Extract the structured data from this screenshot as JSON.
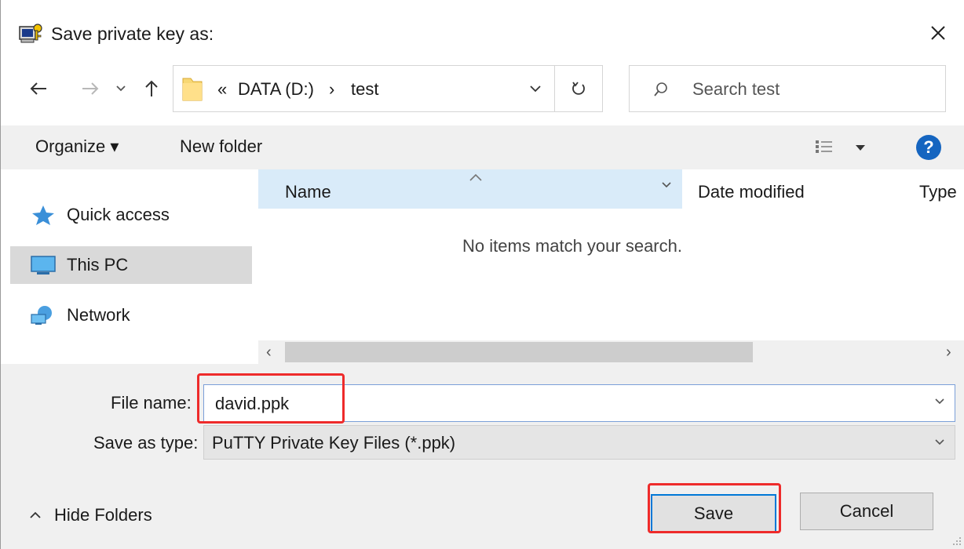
{
  "window": {
    "title": "Save private key as:"
  },
  "navigation": {
    "breadcrumb_prefix": "«",
    "breadcrumbs": [
      "DATA (D:)",
      "test"
    ],
    "breadcrumb_separator": "›",
    "search_placeholder": "Search test"
  },
  "toolbar": {
    "organize_label": "Organize ▾",
    "new_folder_label": "New folder"
  },
  "sidebar": {
    "items": [
      {
        "label": "Quick access",
        "icon": "star-icon"
      },
      {
        "label": "This PC",
        "icon": "computer-icon",
        "selected": true
      },
      {
        "label": "Network",
        "icon": "network-icon"
      }
    ]
  },
  "file_list": {
    "columns": [
      "Name",
      "Date modified",
      "Type"
    ],
    "empty_message": "No items match your search."
  },
  "form": {
    "filename_label": "File name:",
    "filename_value": "david.ppk",
    "savetype_label": "Save as type:",
    "savetype_value": "PuTTY Private Key Files (*.ppk)"
  },
  "footer": {
    "hide_folders_label": "Hide Folders",
    "save_label": "Save",
    "cancel_label": "Cancel"
  },
  "colors": {
    "accent": "#0078d7",
    "highlight": "#ee2b2b",
    "header_selected": "#d9ebf9",
    "sidebar_selected": "#d9d9d9"
  }
}
